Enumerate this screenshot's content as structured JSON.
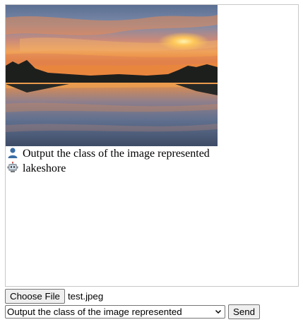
{
  "chat": {
    "messages": [
      {
        "role": "user",
        "icon": "user-icon",
        "text": "Output the class of the image represented"
      },
      {
        "role": "bot",
        "icon": "robot-icon",
        "text": "lakeshore"
      }
    ]
  },
  "controls": {
    "choose_file_label": "Choose File",
    "file_name": "test.jpeg",
    "prompt_selected": "Output the class of the image represented",
    "send_label": "Send"
  },
  "colors": {
    "border": "#c8c8c8",
    "button_bg": "#efefef",
    "button_border": "#767676"
  }
}
